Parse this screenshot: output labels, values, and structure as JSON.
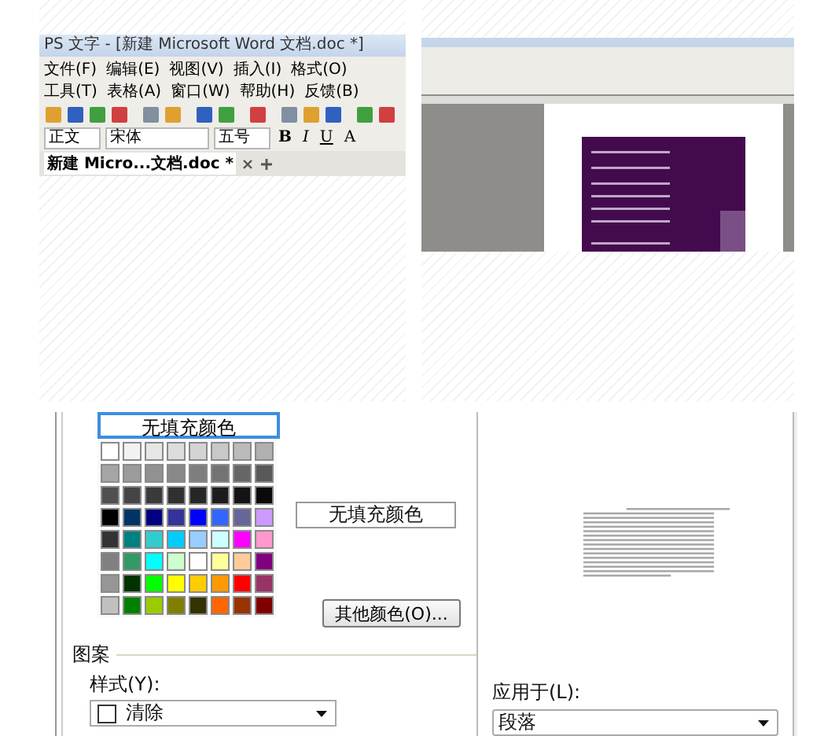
{
  "editor_window": {
    "title": "PS 文字 - [新建 Microsoft Word 文档.doc *]",
    "menu": [
      "文件(F)",
      "编辑(E)",
      "视图(V)",
      "插入(I)",
      "格式(O)",
      "工具(T)",
      "表格(A)",
      "窗口(W)",
      "帮助(H)",
      "反馈(B)"
    ],
    "style_box": "正文",
    "font_box": "宋体",
    "size_box": "五号",
    "format_buttons": [
      "B",
      "I",
      "U",
      "A"
    ],
    "document_tab": "新建 Micro...文档.doc *"
  },
  "fill_dialog": {
    "no_fill_button": {
      "label": "无填充颜色",
      "selected": true
    },
    "swatches": [
      [
        {
          "color": "#ffffff"
        },
        {
          "color": "#f2f2f2"
        },
        {
          "color": "#e6e6e6"
        },
        {
          "color": "#dddddd"
        },
        {
          "color": "#d4d4d4"
        },
        {
          "color": "#c8c8c8"
        },
        {
          "color": "#bbbbbb"
        },
        {
          "color": "#b0b0b0"
        }
      ],
      [
        {
          "color": "#a5a5a5"
        },
        {
          "color": "#9b9b9b"
        },
        {
          "color": "#919191"
        },
        {
          "color": "#888888"
        },
        {
          "color": "#7e7e7e"
        },
        {
          "color": "#737373"
        },
        {
          "color": "#666666"
        },
        {
          "color": "#595959"
        }
      ],
      [
        {
          "color": "#505050"
        },
        {
          "color": "#454545"
        },
        {
          "color": "#3a3a3a"
        },
        {
          "color": "#303030"
        },
        {
          "color": "#262626"
        },
        {
          "color": "#1c1c1c"
        },
        {
          "color": "#141414"
        },
        {
          "color": "#0a0a0a"
        }
      ],
      [
        {
          "color": "#000000"
        },
        {
          "color": "#003366"
        },
        {
          "color": "#000080"
        },
        {
          "color": "#333399"
        },
        {
          "color": "#0000ff"
        },
        {
          "color": "#3366ff"
        },
        {
          "color": "#666699"
        },
        {
          "color": "#cc99ff"
        }
      ],
      [
        {
          "color": "#333333"
        },
        {
          "color": "#008080"
        },
        {
          "color": "#33cccc"
        },
        {
          "color": "#00ccff"
        },
        {
          "color": "#99ccff"
        },
        {
          "color": "#ccffff"
        },
        {
          "color": "#ff00ff"
        },
        {
          "color": "#ff99cc"
        }
      ],
      [
        {
          "color": "#808080"
        },
        {
          "color": "#339966"
        },
        {
          "color": "#00ffff"
        },
        {
          "color": "#ccffcc"
        },
        {
          "color": "#ffffff"
        },
        {
          "color": "#ffff99"
        },
        {
          "color": "#ffcc99"
        },
        {
          "color": "#800080"
        }
      ],
      [
        {
          "color": "#969696"
        },
        {
          "color": "#003300"
        },
        {
          "color": "#00ff00"
        },
        {
          "color": "#ffff00"
        },
        {
          "color": "#ffcc00"
        },
        {
          "color": "#ff9900"
        },
        {
          "color": "#ff0000"
        },
        {
          "color": "#993366"
        }
      ],
      [
        {
          "color": "#c0c0c0"
        },
        {
          "color": "#008000"
        },
        {
          "color": "#99cc00"
        },
        {
          "color": "#808000"
        },
        {
          "color": "#333300"
        },
        {
          "color": "#ff6600"
        },
        {
          "color": "#993300"
        },
        {
          "color": "#800000"
        }
      ]
    ],
    "fill_preview": "无填充颜色",
    "more_colors_button": "其他颜色(O)...",
    "pattern_group": "图案",
    "style_label": "样式(Y):",
    "style_dropdown": "清除",
    "apply_to_label": "应用于(L):",
    "apply_to_dropdown": "段落"
  }
}
